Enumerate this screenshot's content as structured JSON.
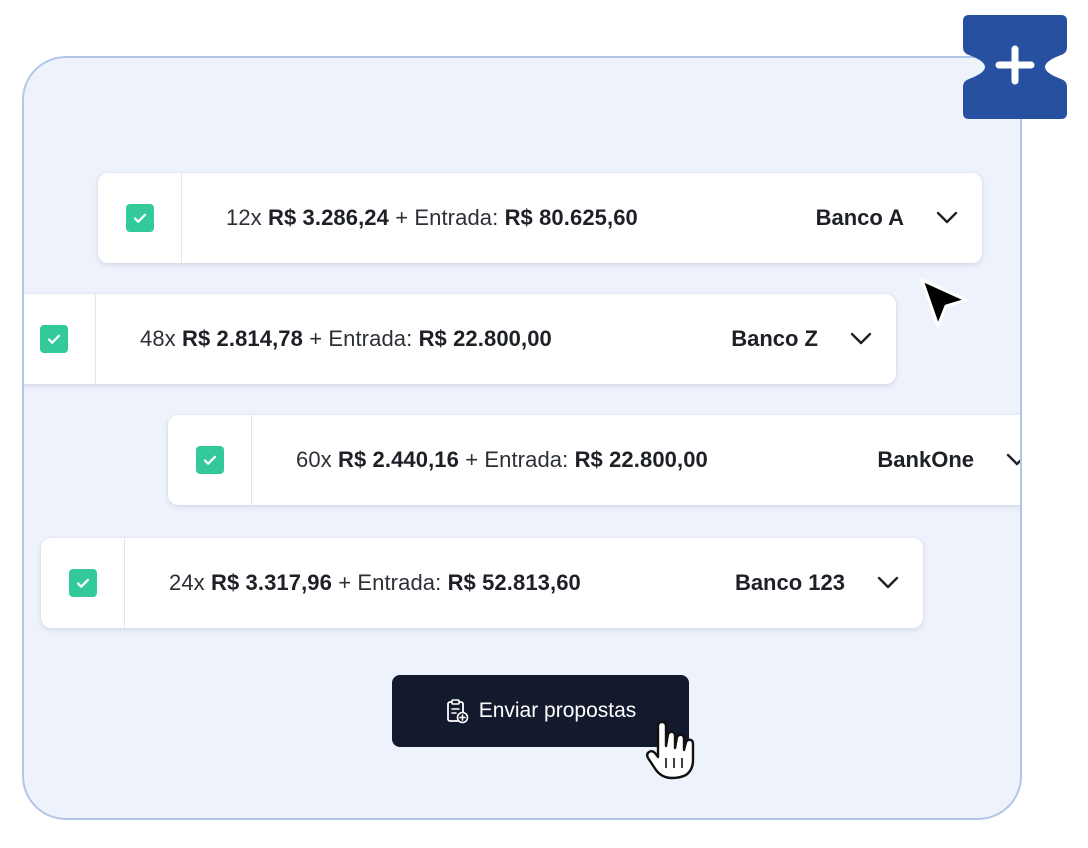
{
  "offers": [
    {
      "installments": "12x",
      "installment_value": "R$ 3.286,24",
      "plus_entry_label": "+ Entrada:",
      "entry_value": "R$ 80.625,60",
      "bank": "Banco A",
      "checked": true
    },
    {
      "installments": "48x",
      "installment_value": "R$ 2.814,78",
      "plus_entry_label": "+ Entrada:",
      "entry_value": "R$ 22.800,00",
      "bank": "Banco Z",
      "checked": true
    },
    {
      "installments": "60x",
      "installment_value": "R$ 2.440,16",
      "plus_entry_label": "+ Entrada:",
      "entry_value": "R$ 22.800,00",
      "bank": "BankOne",
      "checked": true
    },
    {
      "installments": "24x",
      "installment_value": "R$ 3.317,96",
      "plus_entry_label": "+ Entrada:",
      "entry_value": "R$ 52.813,60",
      "bank": "Banco 123",
      "checked": true
    }
  ],
  "send_button": {
    "label": "Enviar propostas",
    "icon": "clipboard-add-icon"
  },
  "plus_badge": {
    "icon": "plus-icon",
    "color": "#2850a0"
  },
  "colors": {
    "accent_check": "#34c99a",
    "button_bg": "#131a2e",
    "panel_bg": "#eef2fb",
    "panel_border": "#b3c6ea"
  }
}
